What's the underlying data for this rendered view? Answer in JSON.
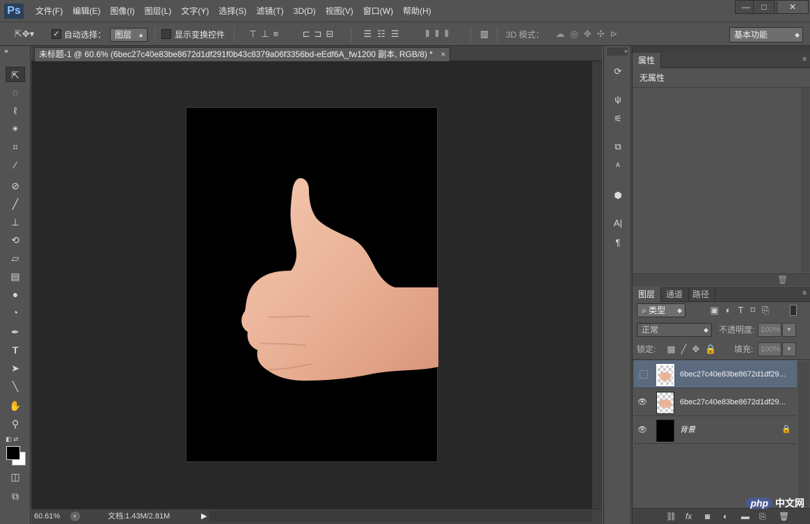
{
  "app": {
    "logo": "Ps"
  },
  "menu": [
    "文件(F)",
    "编辑(E)",
    "图像(I)",
    "图层(L)",
    "文字(Y)",
    "选择(S)",
    "滤镜(T)",
    "3D(D)",
    "视图(V)",
    "窗口(W)",
    "帮助(H)"
  ],
  "window_controls": [
    "—",
    "□",
    "✕"
  ],
  "options": {
    "auto_select_label": "自动选择：",
    "auto_select_checked": true,
    "auto_select_value": "图层",
    "show_transform_label": "显示变换控件",
    "mode_3d_label": "3D 模式：",
    "workspace": "基本功能"
  },
  "document": {
    "tab_title": "未标题-1 @ 60.6% (6bec27c40e83be8672d1df291f0b43c8379a06f3356bd-eEdf6A_fw1200 副本, RGB/8) *",
    "tab_close": "×",
    "zoom": "60.61%",
    "doc_size": "文档:1.43M/2.81M"
  },
  "properties": {
    "tab": "属性",
    "content": "无属性"
  },
  "layers_panel": {
    "tabs": [
      "图层",
      "通道",
      "路径"
    ],
    "filter_kind": "类型",
    "blend_mode": "正常",
    "opacity_label": "不透明度:",
    "opacity_value": "100%",
    "lock_label": "锁定:",
    "fill_label": "填充:",
    "fill_value": "100%",
    "layers": [
      {
        "name": "6bec27c40e83be8672d1df29...",
        "visible": false,
        "selected": true
      },
      {
        "name": "6bec27c40e83be8672d1df29...",
        "visible": true,
        "selected": false
      },
      {
        "name": "背景",
        "visible": true,
        "selected": false,
        "locked": true
      }
    ]
  },
  "watermark": {
    "badge": "php",
    "text": "中文网"
  },
  "colors": {
    "accent_selected_layer": "#5c6a80",
    "canvas_bg": "#000000",
    "workspace_bg": "#282828"
  }
}
